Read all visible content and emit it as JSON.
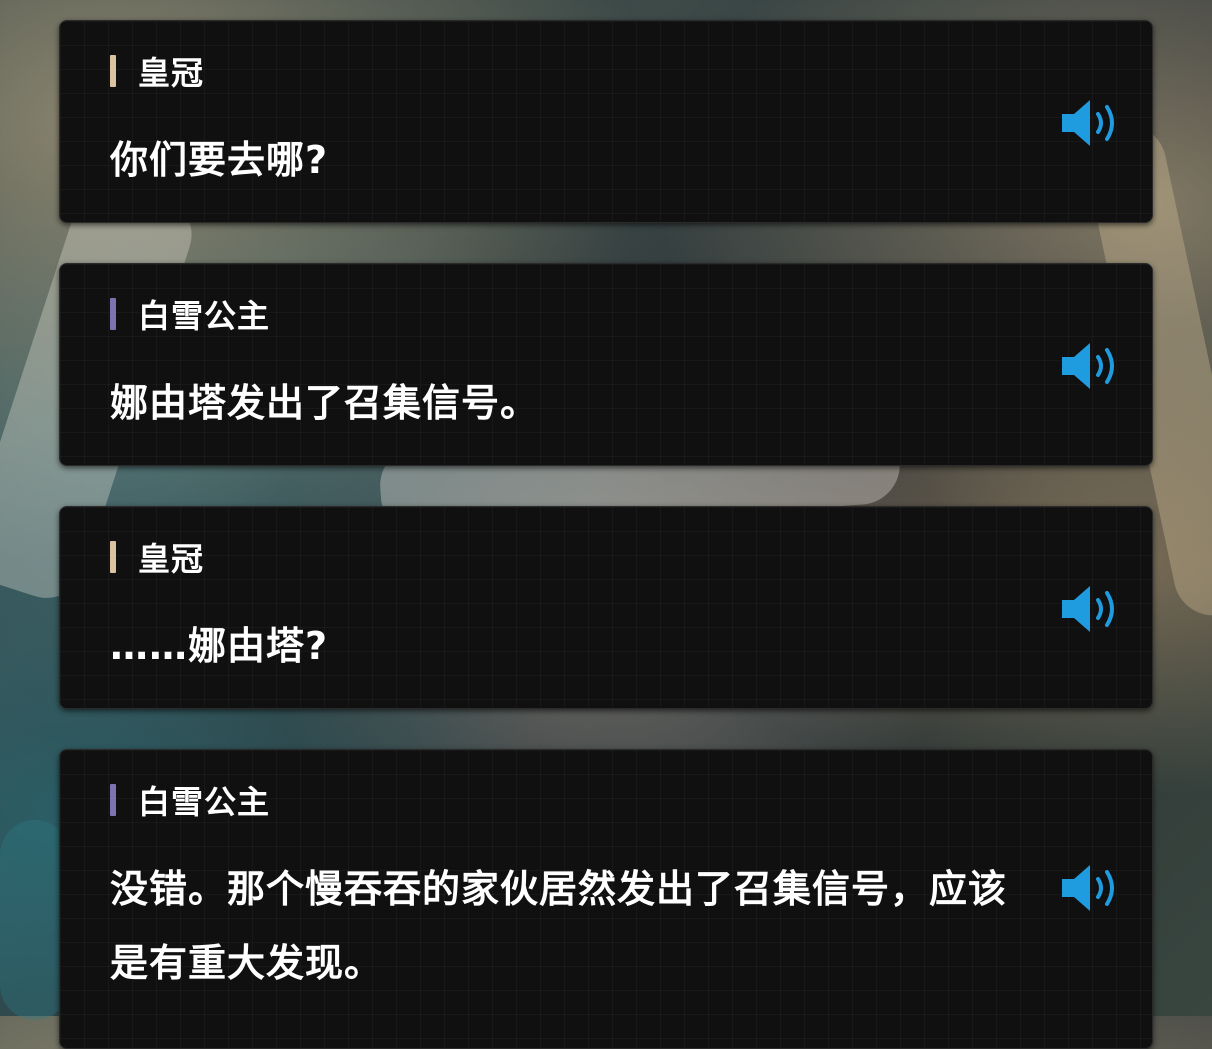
{
  "colors": {
    "speaker_crown": "#d9c3a0",
    "speaker_snow_white": "#7b74b0",
    "voice_icon": "#1f9be0",
    "card_background": "#101010"
  },
  "dialogue": [
    {
      "speaker": "皇冠",
      "text": "你们要去哪?",
      "icon": "speaker-volume-icon"
    },
    {
      "speaker": "白雪公主",
      "text": "娜由塔发出了召集信号。",
      "icon": "speaker-volume-icon"
    },
    {
      "speaker": "皇冠",
      "text": "……娜由塔?",
      "icon": "speaker-volume-icon"
    },
    {
      "speaker": "白雪公主",
      "text": "没错。那个慢吞吞的家伙居然发出了召集信号，应该是有重大发现。",
      "icon": "speaker-volume-icon"
    }
  ]
}
